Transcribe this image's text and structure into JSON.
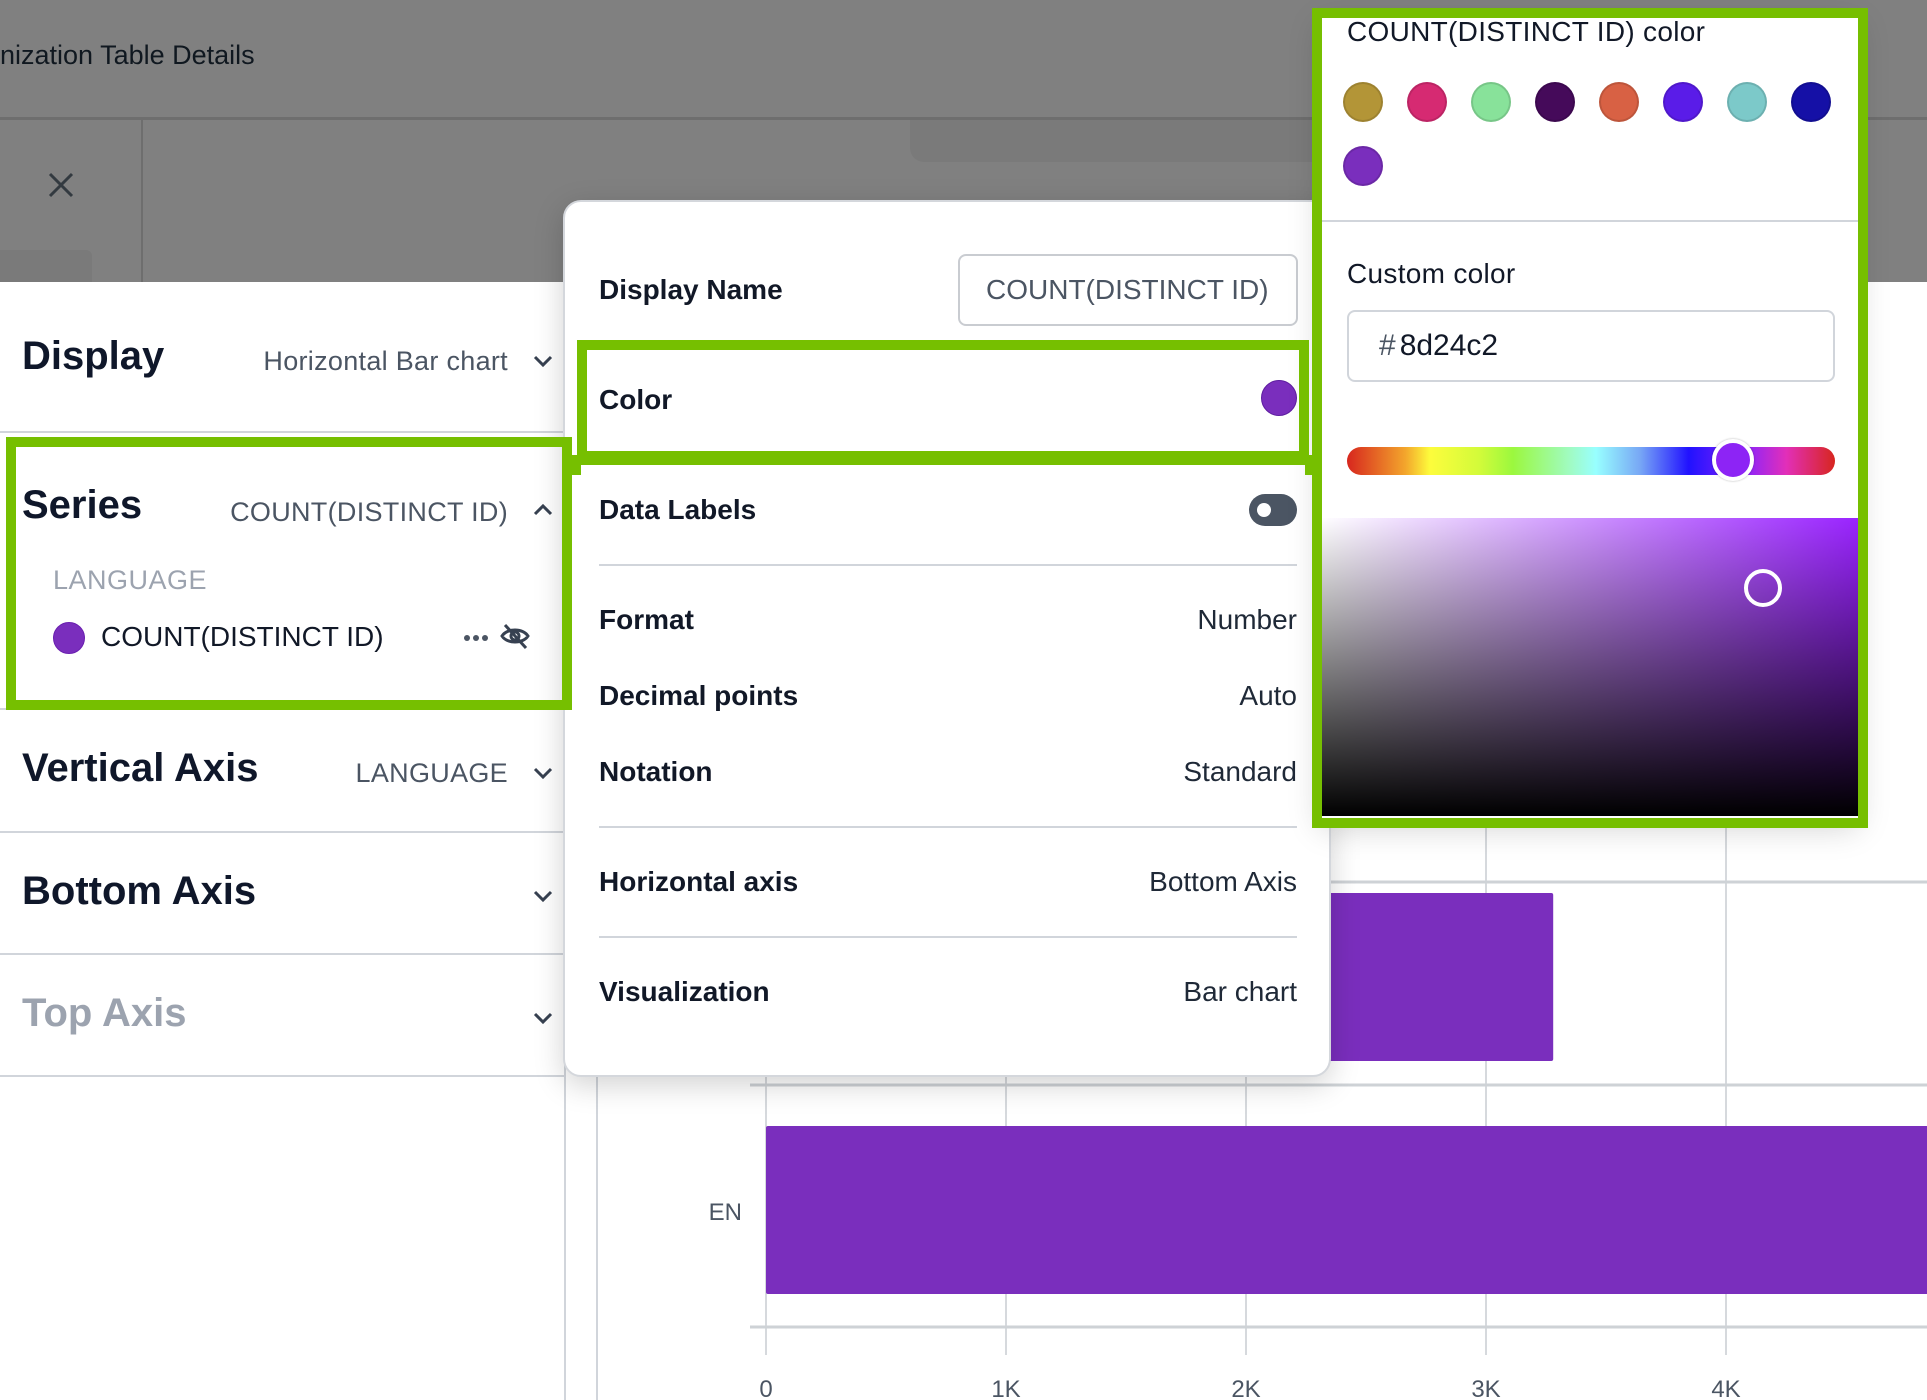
{
  "header": {
    "title": "nization Table Details"
  },
  "settings": {
    "display": {
      "label": "Display",
      "value": "Horizontal Bar chart"
    },
    "series": {
      "label": "Series",
      "value": "COUNT(DISTINCT ID)",
      "group_label": "LANGUAGE",
      "items": [
        {
          "name": "COUNT(DISTINCT ID)",
          "color": "#7a2ebd"
        }
      ]
    },
    "vertical_axis": {
      "label": "Vertical Axis",
      "value": "LANGUAGE"
    },
    "bottom_axis": {
      "label": "Bottom Axis"
    },
    "top_axis": {
      "label": "Top Axis"
    }
  },
  "series_popover": {
    "display_name_label": "Display Name",
    "display_name_value": "COUNT(DISTINCT ID)",
    "color_label": "Color",
    "color_value": "#7a2ebd",
    "data_labels_label": "Data Labels",
    "data_labels_enabled": false,
    "format_label": "Format",
    "format_value": "Number",
    "decimal_label": "Decimal points",
    "decimal_value": "Auto",
    "notation_label": "Notation",
    "notation_value": "Standard",
    "haxis_label": "Horizontal axis",
    "haxis_value": "Bottom Axis",
    "viz_label": "Visualization",
    "viz_value": "Bar chart"
  },
  "color_picker": {
    "title": "COUNT(DISTINCT ID) color",
    "swatches": [
      "#b39537",
      "#d62a72",
      "#88e29a",
      "#450a5a",
      "#d86144",
      "#5a1ce8",
      "#7cc9c9",
      "#1510a6",
      "#7a2ebd"
    ],
    "custom_label": "Custom color",
    "hex_prefix": "#",
    "hex_value": "8d24c2",
    "hue_fraction": 0.79
  },
  "chart_data": {
    "type": "bar",
    "orientation": "horizontal",
    "categories": [
      "",
      "EN"
    ],
    "series": [
      {
        "name": "COUNT(DISTINCT ID)",
        "values": [
          3280,
          5000
        ],
        "color": "#7a2ebd"
      }
    ],
    "xticks": [
      "0",
      "1K",
      "2K",
      "3K",
      "4K"
    ],
    "xlim": [
      0,
      5000
    ],
    "xlabel": "",
    "ylabel": "",
    "grid": true
  }
}
